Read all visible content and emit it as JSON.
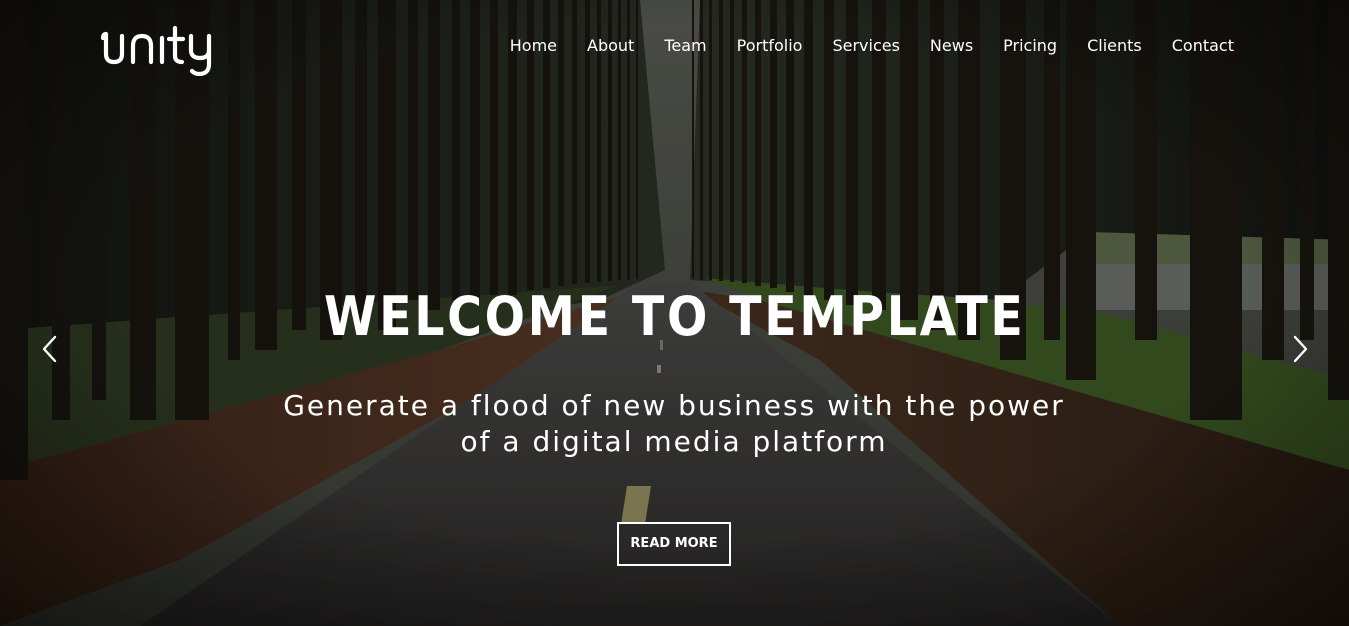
{
  "brand": {
    "logo_text": "unity"
  },
  "nav": {
    "items": [
      {
        "label": "Home"
      },
      {
        "label": "About"
      },
      {
        "label": "Team"
      },
      {
        "label": "Portfolio"
      },
      {
        "label": "Services"
      },
      {
        "label": "News"
      },
      {
        "label": "Pricing"
      },
      {
        "label": "Clients"
      },
      {
        "label": "Contact"
      }
    ]
  },
  "hero": {
    "title": "WELCOME TO TEMPLATE",
    "subtitle": "Generate a flood of new business with the power of a digital media platform",
    "cta_label": "READ MORE",
    "background": "forest-road-photo"
  },
  "carousel": {
    "prev_icon": "chevron-left-icon",
    "next_icon": "chevron-right-icon"
  },
  "colors": {
    "text": "#ffffff",
    "overlay": "#000000"
  }
}
